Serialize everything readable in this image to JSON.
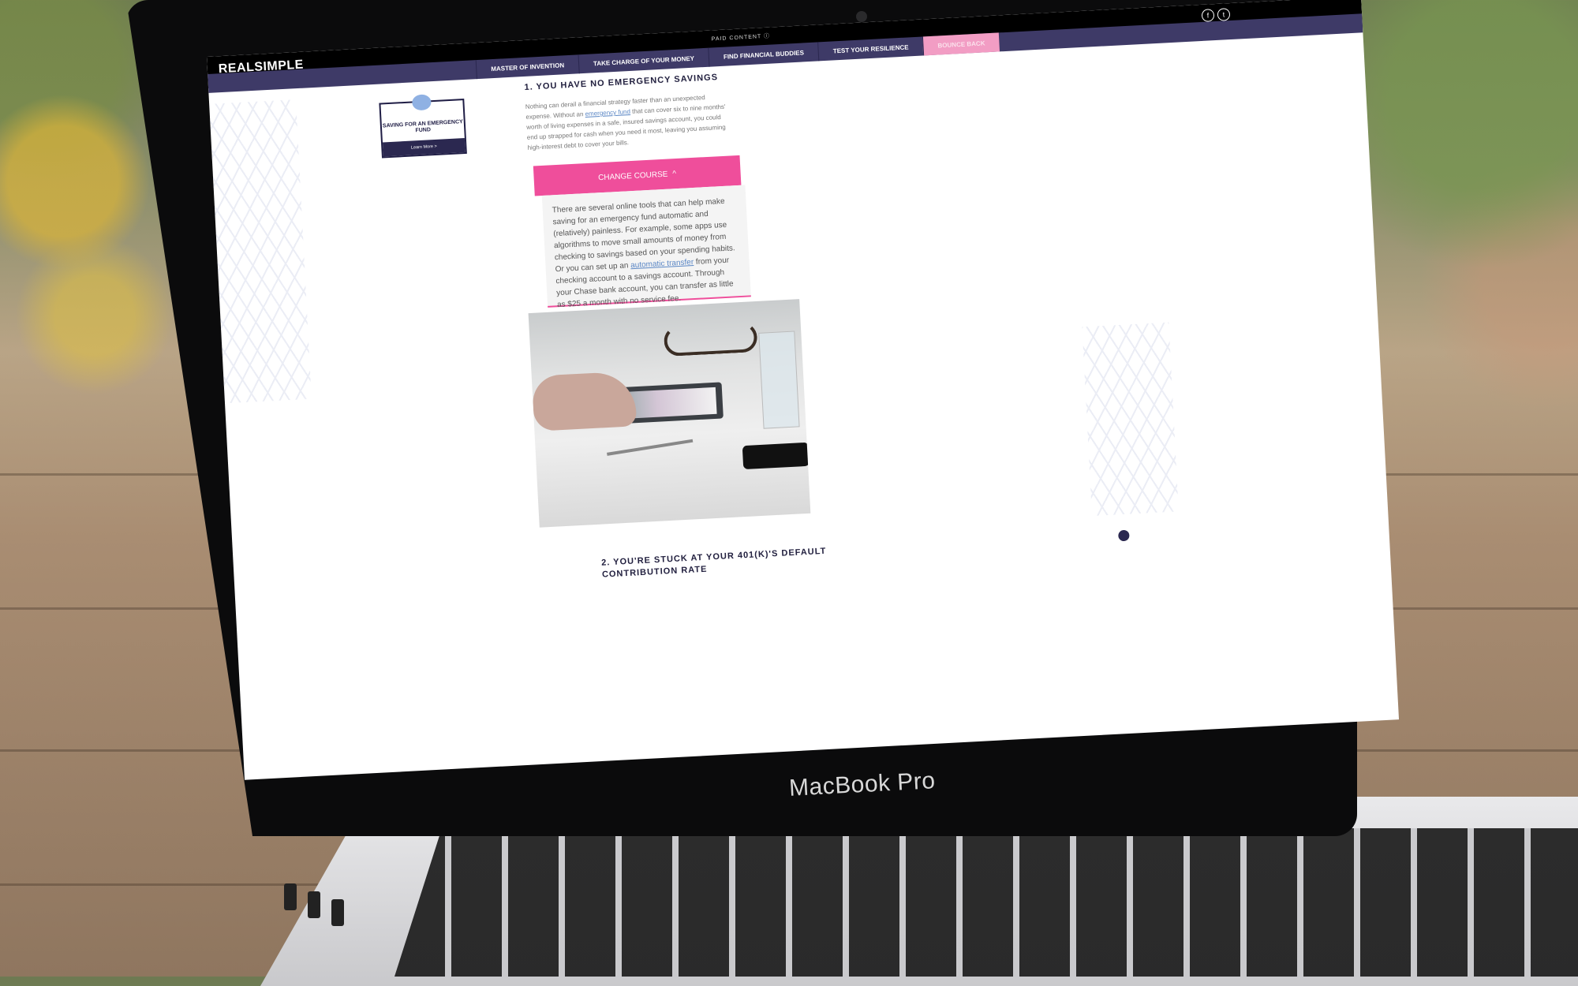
{
  "device": {
    "model_label": "MacBook Pro"
  },
  "site": {
    "logo": "REALSIMPLE",
    "paid_label": "PAID CONTENT ⓘ",
    "social_icons": [
      "facebook-icon",
      "twitter-icon"
    ]
  },
  "nav": {
    "tabs": [
      {
        "label": "MASTER OF INVENTION",
        "active": false
      },
      {
        "label": "TAKE CHARGE OF YOUR MONEY",
        "active": false
      },
      {
        "label": "FIND FINANCIAL BUDDIES",
        "active": false
      },
      {
        "label": "TEST YOUR RESILIENCE",
        "active": false
      },
      {
        "label": "BOUNCE BACK",
        "active": true
      }
    ]
  },
  "promo": {
    "title": "SAVING FOR AN EMERGENCY FUND",
    "cta": "Learn More >",
    "icon": "piggy-bank-icon"
  },
  "section1": {
    "heading": "1. YOU HAVE NO EMERGENCY SAVINGS",
    "para_before": "Nothing can derail a financial strategy faster than an unexpected expense. Without an ",
    "link": "emergency fund",
    "para_after": " that can cover six to nine months' worth of living expenses in a safe, insured savings account, you could end up strapped for cash when you need it most, leaving you assuming high-interest debt to cover your bills."
  },
  "accordion": {
    "label": "CHANGE COURSE",
    "icon": "chevron-up-icon",
    "text_before": "There are several online tools that can help make saving for an emergency fund automatic and (relatively) painless. For example, some apps use algorithms to move small amounts of money from checking to savings based on your spending habits. Or you can set up an ",
    "link": "automatic transfer",
    "text_after": " from your checking account to a savings account. Through your Chase bank account, you can transfer as little as $25 a month with no service fee."
  },
  "section2": {
    "heading": "2. YOU'RE STUCK AT YOUR 401(K)'S DEFAULT CONTRIBUTION RATE"
  },
  "colors": {
    "nav_bg": "#3e3a67",
    "accent_pink": "#ef4e9b",
    "active_tab": "#f29dc4",
    "link": "#5b87c5"
  }
}
